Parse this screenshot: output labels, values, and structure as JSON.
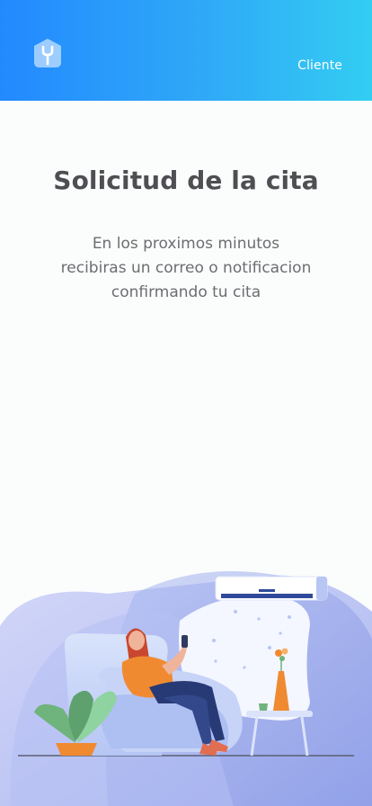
{
  "header": {
    "logo_icon": "house-wrench-icon",
    "client_link": "Cliente",
    "gradient": [
      "#2389ff",
      "#33cdf2"
    ]
  },
  "main": {
    "title": "Solicitud de la cita",
    "message_lines": [
      "En los proximos minutos",
      "recibiras un correo o notificacion",
      "confirmando tu cita"
    ]
  },
  "illustration": {
    "icon": "woman-relaxing-under-air-conditioner-illustration"
  }
}
